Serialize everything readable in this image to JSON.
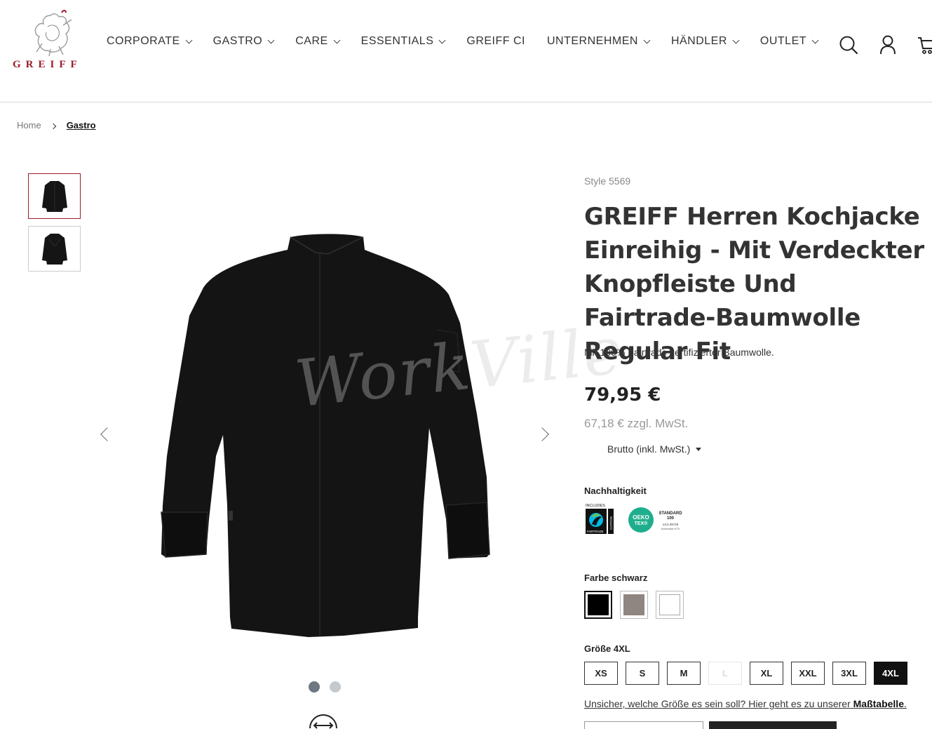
{
  "header": {
    "brand": "GREIFF",
    "nav": [
      {
        "label": "CORPORATE",
        "has_dropdown": true
      },
      {
        "label": "GASTRO",
        "has_dropdown": true
      },
      {
        "label": "CARE",
        "has_dropdown": true
      },
      {
        "label": "ESSENTIALS",
        "has_dropdown": true
      },
      {
        "label": "GREIFF CI",
        "has_dropdown": false
      },
      {
        "label": "UNTERNEHMEN",
        "has_dropdown": true
      },
      {
        "label": "HÄNDLER",
        "has_dropdown": true
      },
      {
        "label": "OUTLET",
        "has_dropdown": true
      }
    ],
    "icons": [
      "search-icon",
      "account-icon",
      "cart-icon"
    ]
  },
  "breadcrumb": {
    "home": "Home",
    "current": "Gastro"
  },
  "gallery": {
    "thumbnails": [
      "front-view",
      "back-view"
    ],
    "active_thumbnail": 0,
    "watermark": "WorkVille",
    "dots": 2,
    "active_dot": 0
  },
  "product": {
    "style": "Style 5569",
    "title": "GREIFF Herren Kochjacke Einreihig - Mit Verdeckter Knopfleiste Und Fairtrade-Baumwolle Regular Fit",
    "subtitle": "Mit 100% Fairtrade zertifizierter Baumwolle.",
    "price": "79,95 €",
    "net_price": "67,18 € zzgl. MwSt.",
    "tax_mode": "Brutto (inkl. MwSt.)"
  },
  "sustainability": {
    "label": "Nachhaltigkeit",
    "fairtrade": {
      "top": "INCLUDES",
      "bottom": "FAIRTRADE",
      "side": "COTTON"
    },
    "oeko": {
      "name_1": "OEKO",
      "name_2": "TEX®",
      "standard_1": "STANDARD",
      "standard_2": "100",
      "code": "13.0.39740",
      "institute": "Hohenstein HTTI"
    }
  },
  "color": {
    "label": "Farbe schwarz",
    "options": [
      {
        "name": "schwarz",
        "hex": "#000000",
        "selected": true
      },
      {
        "name": "taupe",
        "hex": "#8f8581",
        "selected": false
      },
      {
        "name": "weiss",
        "hex": "#ffffff",
        "selected": false
      }
    ]
  },
  "size": {
    "label": "Größe 4XL",
    "options": [
      {
        "label": "XS",
        "available": true,
        "selected": false
      },
      {
        "label": "S",
        "available": true,
        "selected": false
      },
      {
        "label": "M",
        "available": true,
        "selected": false
      },
      {
        "label": "L",
        "available": false,
        "selected": false
      },
      {
        "label": "XL",
        "available": true,
        "selected": false
      },
      {
        "label": "XXL",
        "available": true,
        "selected": false
      },
      {
        "label": "3XL",
        "available": true,
        "selected": false
      },
      {
        "label": "4XL",
        "available": true,
        "selected": true
      }
    ],
    "help_text": "Unsicher, welche Größe es sein soll? Hier geht es zu unserer ",
    "help_link": "Maßtabelle",
    "help_end": "."
  },
  "colors": {
    "brand_red": "#9b1c2c",
    "text_dark": "#333333",
    "oeko_green": "#1fae8d"
  }
}
